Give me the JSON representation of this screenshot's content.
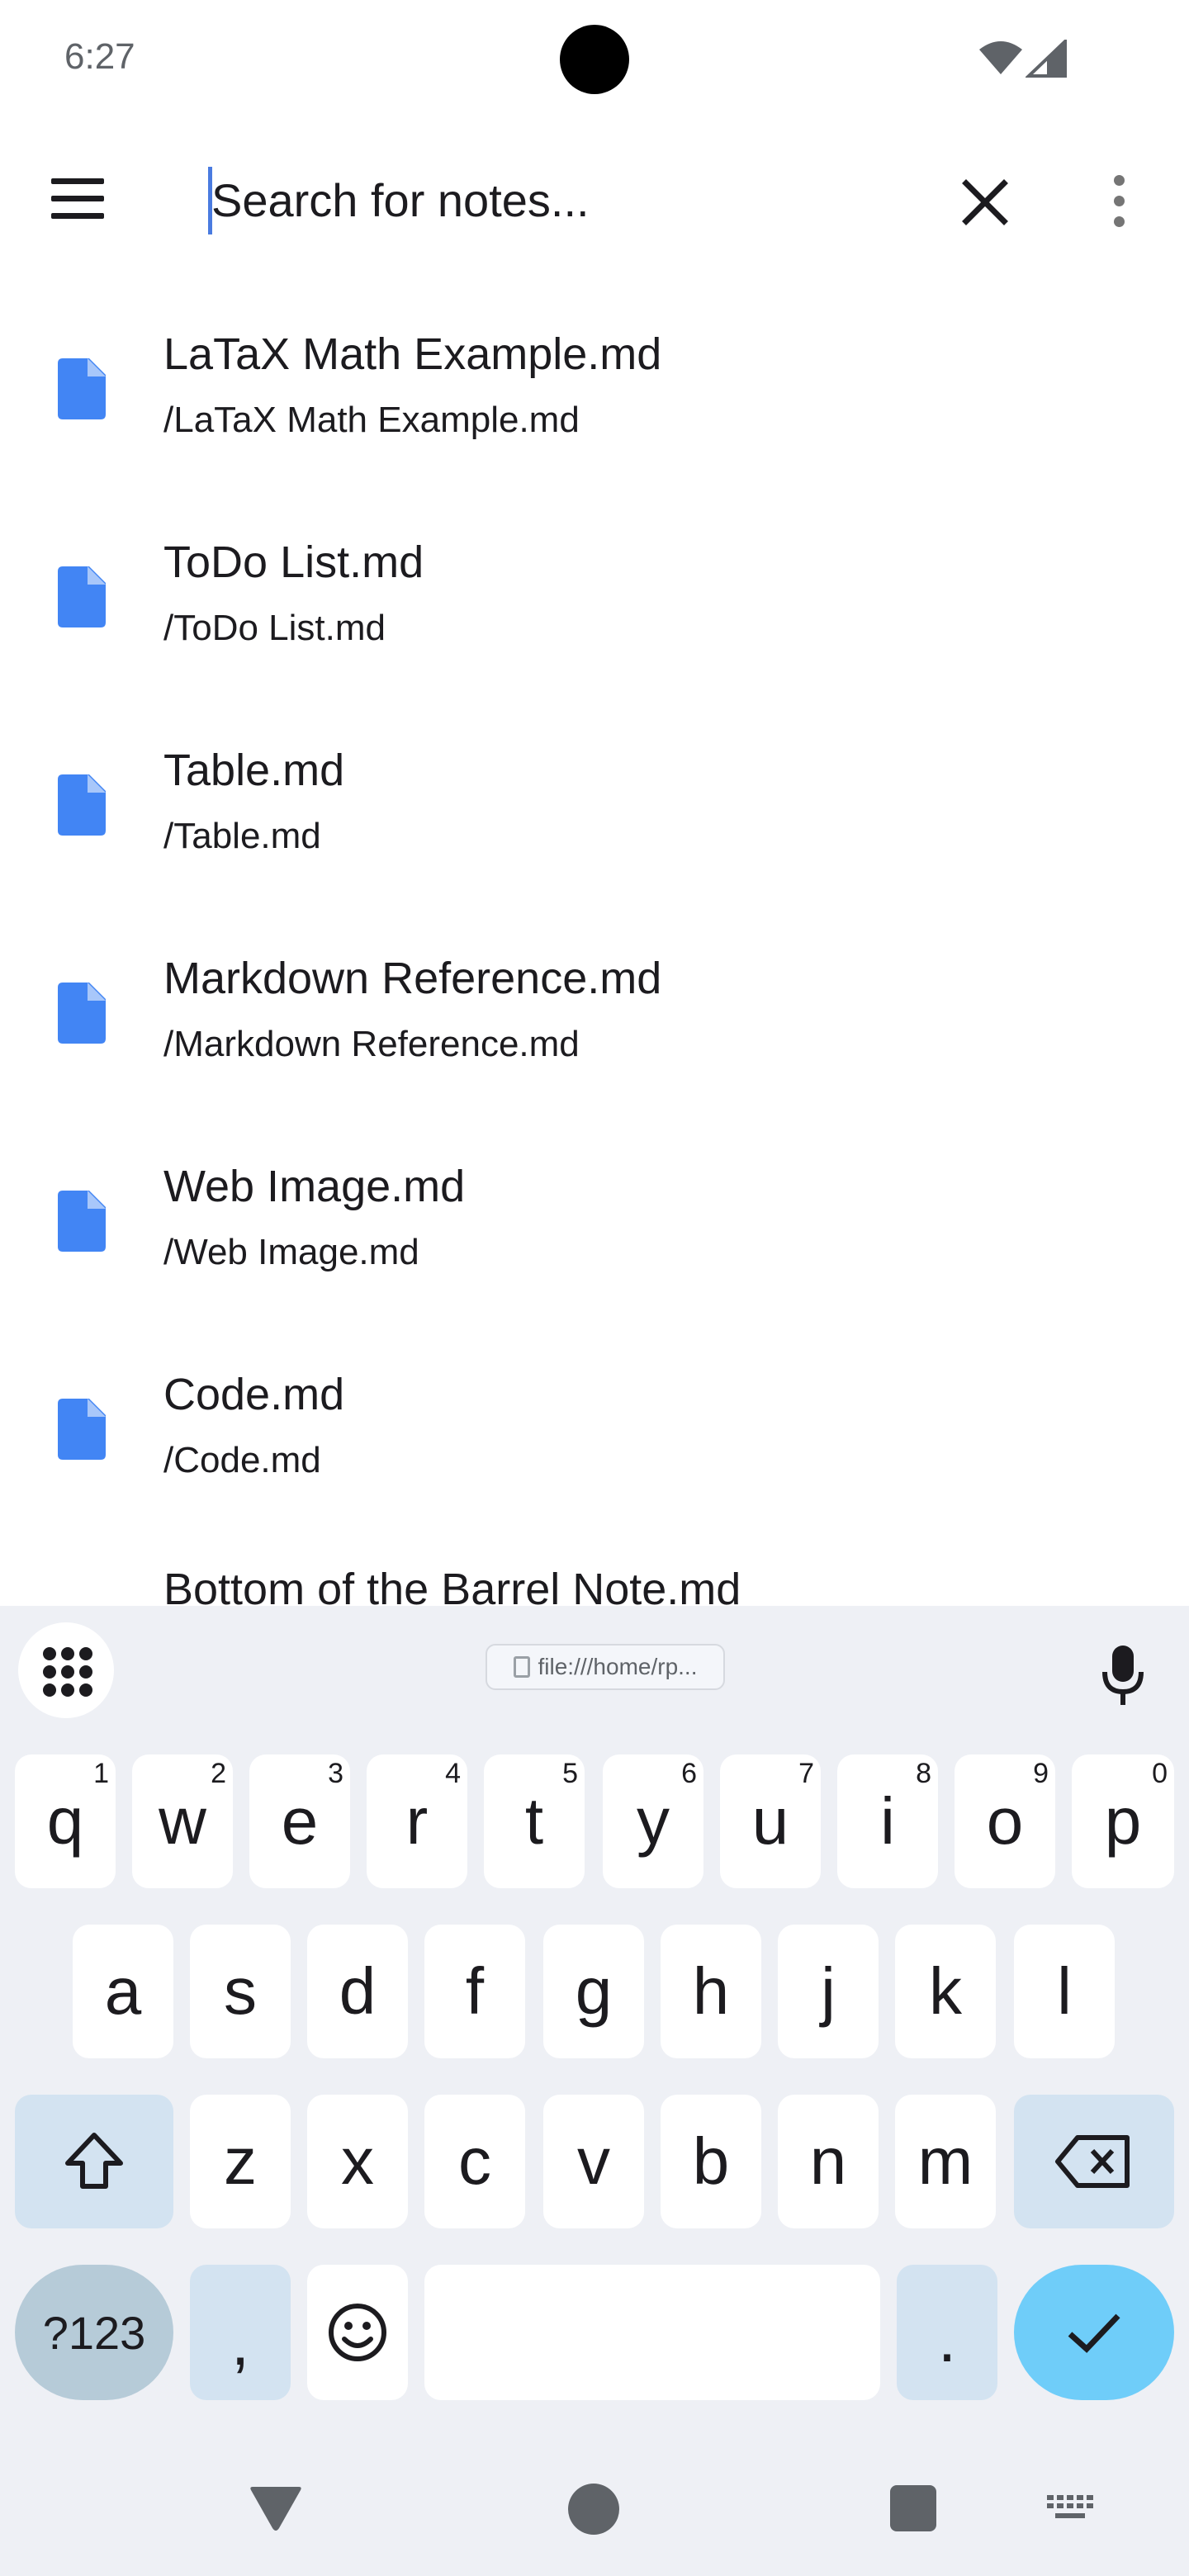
{
  "status_bar": {
    "time": "6:27"
  },
  "app_bar": {
    "search_placeholder": "Search for notes...",
    "search_value": ""
  },
  "notes": [
    {
      "title": "LaTaX Math Example.md",
      "path": "/LaTaX Math Example.md"
    },
    {
      "title": "ToDo List.md",
      "path": "/ToDo List.md"
    },
    {
      "title": "Table.md",
      "path": "/Table.md"
    },
    {
      "title": "Markdown Reference.md",
      "path": "/Markdown Reference.md"
    },
    {
      "title": "Web Image.md",
      "path": "/Web Image.md"
    },
    {
      "title": "Code.md",
      "path": "/Code.md"
    },
    {
      "title": "Bottom of the Barrel Note.md",
      "path": ""
    }
  ],
  "keyboard": {
    "clipboard_chip": "file:///home/rp...",
    "row1": [
      {
        "key": "q",
        "hint": "1"
      },
      {
        "key": "w",
        "hint": "2"
      },
      {
        "key": "e",
        "hint": "3"
      },
      {
        "key": "r",
        "hint": "4"
      },
      {
        "key": "t",
        "hint": "5"
      },
      {
        "key": "y",
        "hint": "6"
      },
      {
        "key": "u",
        "hint": "7"
      },
      {
        "key": "i",
        "hint": "8"
      },
      {
        "key": "o",
        "hint": "9"
      },
      {
        "key": "p",
        "hint": "0"
      }
    ],
    "row2": [
      "a",
      "s",
      "d",
      "f",
      "g",
      "h",
      "j",
      "k",
      "l"
    ],
    "row3": [
      "z",
      "x",
      "c",
      "v",
      "b",
      "n",
      "m"
    ],
    "symbols_label": "?123",
    "comma_label": ",",
    "period_label": "."
  },
  "colors": {
    "accent": "#4285f4",
    "keyboard_bg": "#eef0f5",
    "special_key": "#d3e3f1",
    "enter_key": "#6fcdf9"
  },
  "icons": {
    "menu": "menu-icon",
    "clear": "close-icon",
    "more": "more-vert-icon",
    "note": "file-icon",
    "mic": "mic-icon",
    "shift": "shift-icon",
    "backspace": "backspace-icon",
    "emoji": "emoji-icon",
    "enter": "check-icon"
  }
}
